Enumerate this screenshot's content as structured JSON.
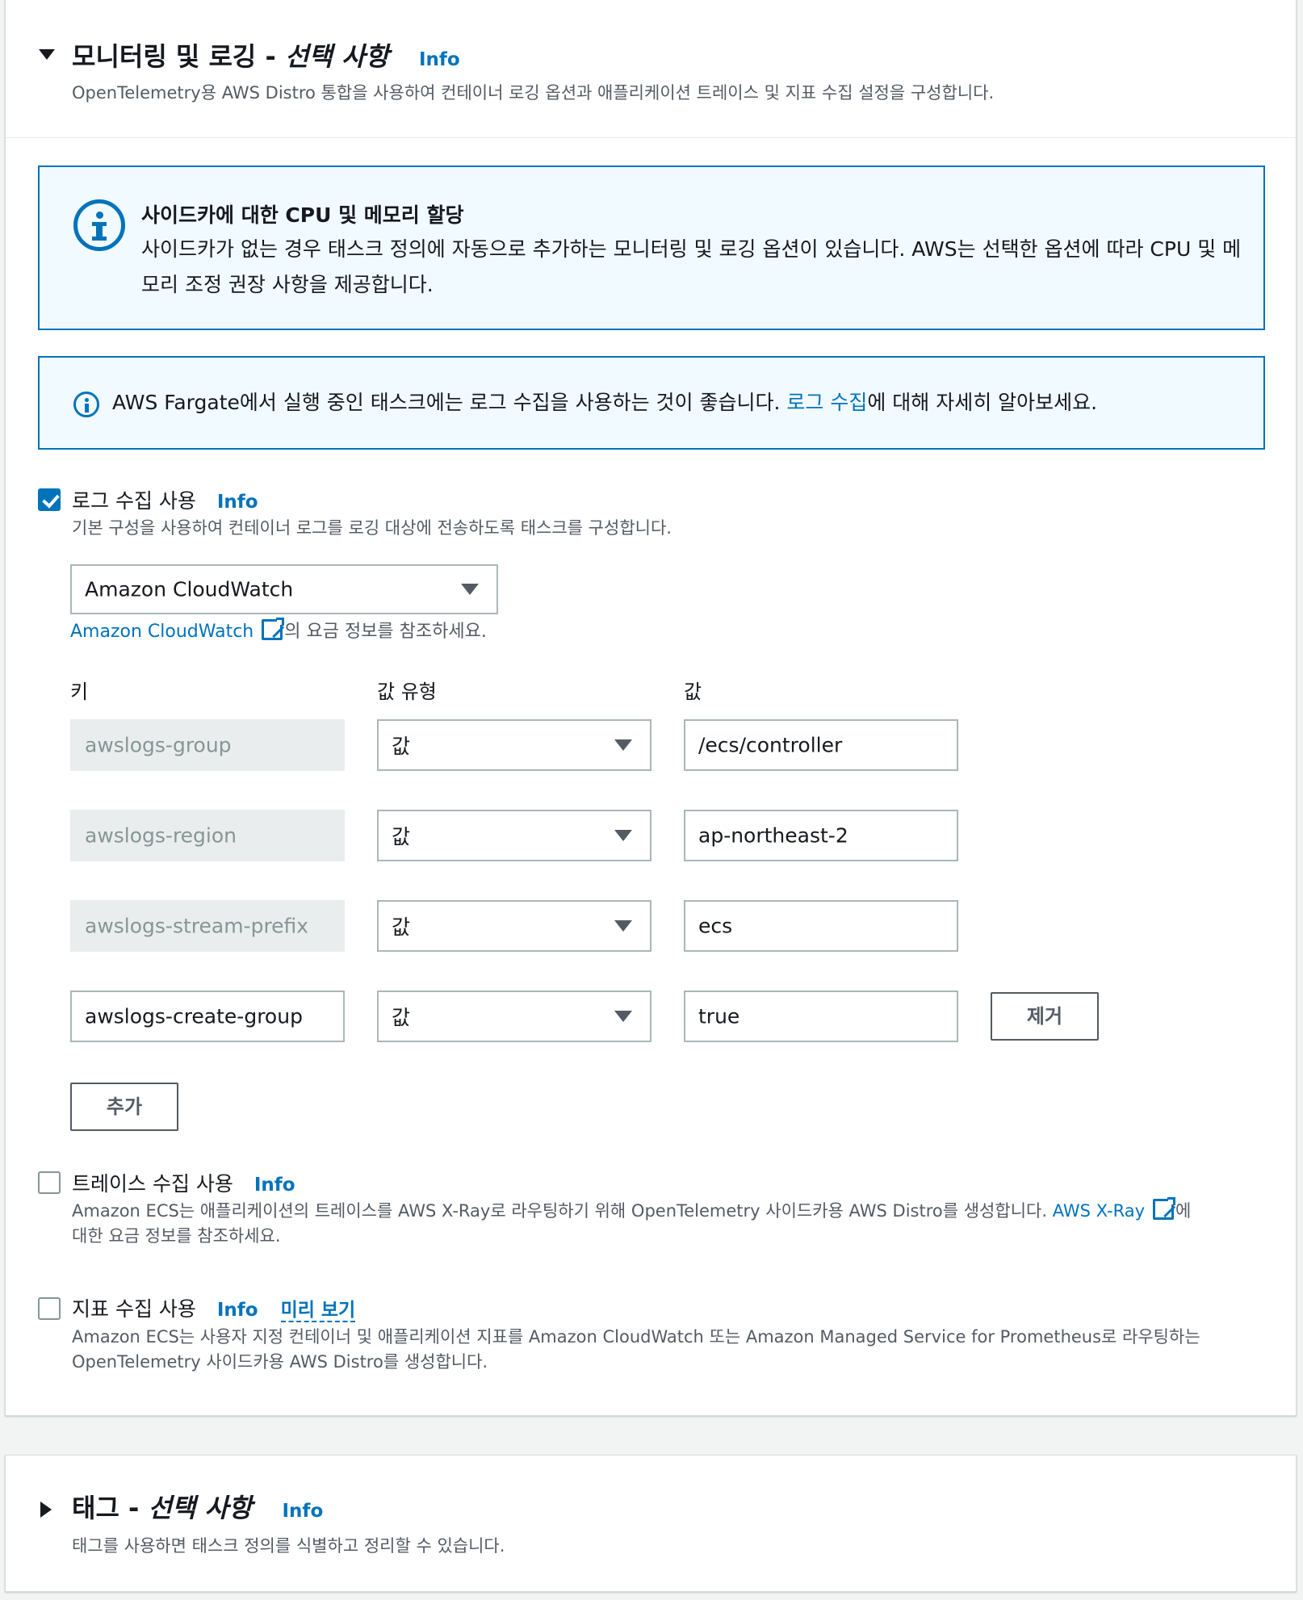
{
  "monitoring": {
    "title_main": "모니터링 및 로깅 -",
    "title_optional": "선택 사항",
    "info": "Info",
    "description": "OpenTelemetry용 AWS Distro 통합을 사용하여 컨테이너 로깅 옵션과 애플리케이션 트레이스 및 지표 수집 설정을 구성합니다."
  },
  "alert_sidecar": {
    "title": "사이드카에 대한 CPU 및 메모리 할당",
    "body": "사이드카가 없는 경우 태스크 정의에 자동으로 추가하는 모니터링 및 로깅 옵션이 있습니다. AWS는 선택한 옵션에 따라 CPU 및 메모리 조정 권장 사항을 제공합니다."
  },
  "alert_fargate": {
    "text_before": "AWS Fargate에서 실행 중인 태스크에는 로그 수집을 사용하는 것이 좋습니다.",
    "link": "로그 수집",
    "text_after": "에 대해 자세히 알아보세요."
  },
  "log_collection": {
    "checked": true,
    "label": "로그 수집 사용",
    "info": "Info",
    "description": "기본 구성을 사용하여 컨테이너 로그를 로깅 대상에 전송하도록 태스크를 구성합니다.",
    "destination": "Amazon CloudWatch",
    "pricing_link": "Amazon CloudWatch",
    "pricing_suffix": "의 요금 정보를 참조하세요.",
    "columns": {
      "key": "키",
      "value_type": "값 유형",
      "value": "값"
    },
    "rows": [
      {
        "key": "awslogs-group",
        "type": "값",
        "value": "/ecs/controller"
      },
      {
        "key": "awslogs-region",
        "type": "값",
        "value": "ap-northeast-2"
      },
      {
        "key": "awslogs-stream-prefix",
        "type": "값",
        "value": "ecs"
      },
      {
        "key": "awslogs-create-group",
        "type": "값",
        "value": "true"
      }
    ],
    "remove_label": "제거",
    "add_label": "추가"
  },
  "trace_collection": {
    "checked": false,
    "label": "트레이스 수집 사용",
    "info": "Info",
    "desc_before": "Amazon ECS는 애플리케이션의 트레이스를 AWS X-Ray로 라우팅하기 위해 OpenTelemetry 사이드카용 AWS Distro를 생성합니다.",
    "link": "AWS X-Ray",
    "desc_after": "에",
    "desc_line2": "대한 요금 정보를 참조하세요."
  },
  "metric_collection": {
    "checked": false,
    "label": "지표 수집 사용",
    "info": "Info",
    "preview": "미리 보기",
    "desc_line1": "Amazon ECS는 사용자 지정 컨테이너 및 애플리케이션 지표를 Amazon CloudWatch 또는 Amazon Managed Service for Prometheus로 라우팅하는",
    "desc_line2": "OpenTelemetry 사이드카용 AWS Distro를 생성합니다."
  },
  "tags": {
    "title_main": "태그 -",
    "title_optional": "선택 사항",
    "info": "Info",
    "description": "태그를 사용하면 태스크 정의를 식별하고 정리할 수 있습니다."
  },
  "colors": {
    "accent": "#0073bb",
    "text": "#16191f",
    "muted": "#545b64",
    "alert_bg": "#f1faff"
  }
}
